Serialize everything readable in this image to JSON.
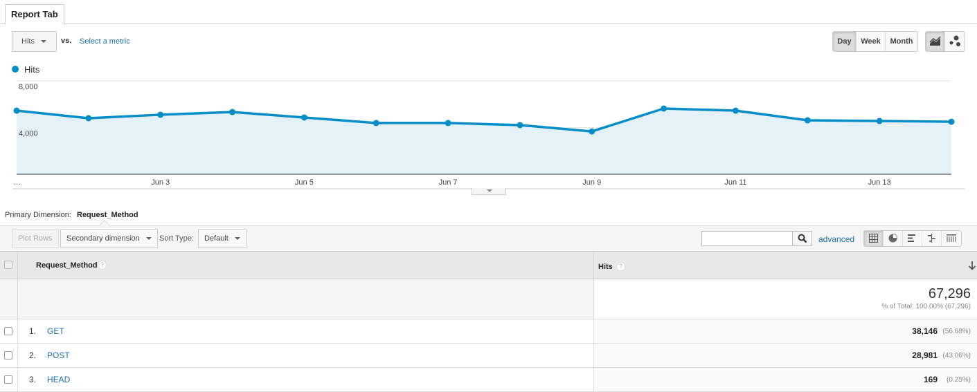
{
  "tabs": [
    {
      "label": "Report Tab",
      "active": true
    }
  ],
  "metric_selector": {
    "value": "Hits",
    "vs_label": "vs.",
    "select_metric_label": "Select a metric"
  },
  "period_buttons": [
    {
      "label": "Day",
      "active": true
    },
    {
      "label": "Week",
      "active": false
    },
    {
      "label": "Month",
      "active": false
    }
  ],
  "chart_type_buttons": [
    {
      "icon": "line-chart-icon",
      "active": true
    },
    {
      "icon": "motion-chart-icon",
      "active": false
    }
  ],
  "legend": {
    "label": "Hits",
    "color": "#058dc7"
  },
  "chart_data": {
    "type": "area",
    "title": "",
    "xlabel": "",
    "ylabel": "",
    "legend": [
      "Hits"
    ],
    "legend_position": "top-left",
    "x": [
      "Jun 1",
      "Jun 2",
      "Jun 3",
      "Jun 4",
      "Jun 5",
      "Jun 6",
      "Jun 7",
      "Jun 8",
      "Jun 9",
      "Jun 10",
      "Jun 11",
      "Jun 12",
      "Jun 13",
      "Jun 14"
    ],
    "x_tick_labels": [
      {
        "index": 0,
        "label": "…"
      },
      {
        "index": 2,
        "label": "Jun 3"
      },
      {
        "index": 4,
        "label": "Jun 5"
      },
      {
        "index": 6,
        "label": "Jun 7"
      },
      {
        "index": 8,
        "label": "Jun 9"
      },
      {
        "index": 10,
        "label": "Jun 11"
      },
      {
        "index": 12,
        "label": "Jun 13"
      }
    ],
    "y_ticks": [
      {
        "value": 4000,
        "label": "4,000"
      },
      {
        "value": 8000,
        "label": "8,000"
      }
    ],
    "ylim": [
      0,
      8000
    ],
    "grid": true,
    "series": [
      {
        "name": "Hits",
        "color": "#058dc7",
        "fill": "#e4f1f9",
        "values": [
          5450,
          4800,
          5100,
          5330,
          4860,
          4390,
          4390,
          4210,
          3670,
          5630,
          5450,
          4620,
          4560,
          4500
        ]
      }
    ]
  },
  "primary_dimension": {
    "label": "Primary Dimension:",
    "value": "Request_Method"
  },
  "toolbar": {
    "plot_rows_label": "Plot Rows",
    "secondary_dimension_label": "Secondary dimension",
    "sort_type_label": "Sort Type:",
    "sort_type_value": "Default",
    "search_placeholder": "",
    "advanced_label": "advanced",
    "view_buttons": [
      "table-view-icon",
      "pie-view-icon",
      "bar-view-icon",
      "comparison-view-icon",
      "pivot-view-icon"
    ]
  },
  "table": {
    "columns": [
      {
        "label": "Request_Method",
        "help": "?"
      },
      {
        "label": "Hits",
        "help": "?",
        "sorted": "descending"
      }
    ],
    "total": {
      "value": "67,296",
      "sub": "% of Total: 100.00% (67,296)"
    },
    "rows": [
      {
        "index": "1.",
        "name": "GET",
        "hits": "38,146",
        "pct": "(56.68%)"
      },
      {
        "index": "2.",
        "name": "POST",
        "hits": "28,981",
        "pct": "(43.06%)"
      },
      {
        "index": "3.",
        "name": "HEAD",
        "hits": "169",
        "pct": "(0.25%)"
      }
    ]
  }
}
